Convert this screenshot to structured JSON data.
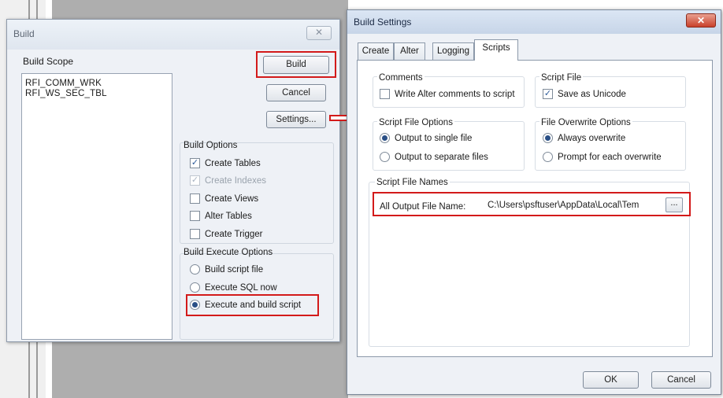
{
  "build_dialog": {
    "title": "Build",
    "close_glyph": "✕",
    "scope_label": "Build Scope",
    "scope_items": [
      "RFI_COMM_WRK",
      "RFI_WS_SEC_TBL"
    ],
    "buttons": {
      "build": "Build",
      "cancel": "Cancel",
      "settings": "Settings..."
    },
    "build_options": {
      "title": "Build Options",
      "items": [
        {
          "label": "Create Tables",
          "checked": true,
          "enabled": true
        },
        {
          "label": "Create Indexes",
          "checked": true,
          "enabled": false
        },
        {
          "label": "Create Views",
          "checked": false,
          "enabled": true
        },
        {
          "label": "Alter Tables",
          "checked": false,
          "enabled": true
        },
        {
          "label": "Create Trigger",
          "checked": false,
          "enabled": true
        }
      ]
    },
    "execute_options": {
      "title": "Build Execute Options",
      "items": [
        {
          "label": "Build script file",
          "selected": false
        },
        {
          "label": "Execute SQL now",
          "selected": false
        },
        {
          "label": "Execute and build script",
          "selected": true
        }
      ]
    }
  },
  "settings_dialog": {
    "title": "Build Settings",
    "close_glyph": "✕",
    "tabs": [
      "Create",
      "Alter",
      "Logging",
      "Scripts"
    ],
    "active_tab": "Scripts",
    "comments": {
      "title": "Comments",
      "label": "Write Alter comments to script",
      "checked": false
    },
    "script_file": {
      "title": "Script File",
      "label": "Save as Unicode",
      "checked": true
    },
    "script_file_options": {
      "title": "Script File Options",
      "items": [
        {
          "label": "Output to single file",
          "selected": true
        },
        {
          "label": "Output to separate files",
          "selected": false
        }
      ]
    },
    "file_overwrite_options": {
      "title": "File Overwrite Options",
      "items": [
        {
          "label": "Always overwrite",
          "selected": true
        },
        {
          "label": "Prompt for each overwrite",
          "selected": false
        }
      ]
    },
    "script_file_names": {
      "title": "Script File Names",
      "label": "All Output File Name:",
      "value": "C:\\Users\\psftuser\\AppData\\Local\\Tem",
      "browse": "..."
    },
    "buttons": {
      "ok": "OK",
      "cancel": "Cancel"
    }
  },
  "check_glyph": "✓",
  "highlight_color": "#d31a1a"
}
